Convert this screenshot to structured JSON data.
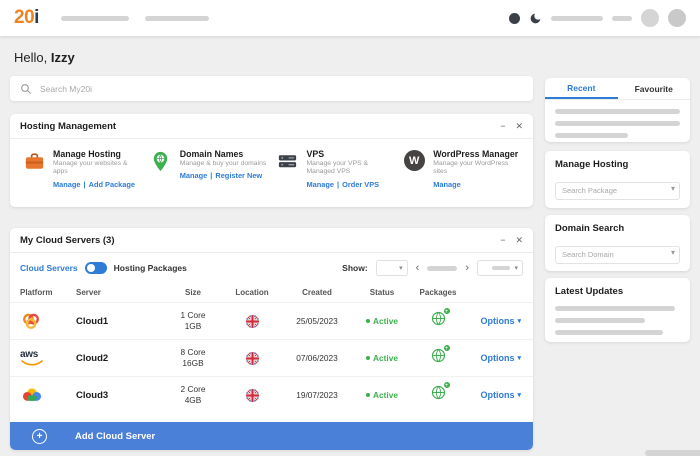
{
  "topbar": {
    "logo_main": "20",
    "logo_i": "i"
  },
  "icons": {
    "minimize": "−",
    "close": "✕",
    "chevron_down": "▾",
    "chevron_left": "‹",
    "chevron_right": "›",
    "plus": "+",
    "pipe": "|",
    "wordpress_w": "W"
  },
  "greeting": {
    "prefix": "Hello,",
    "name": "Izzy"
  },
  "search": {
    "placeholder": "Search My20i"
  },
  "hosting_management": {
    "title": "Hosting Management",
    "items": [
      {
        "title": "Manage Hosting",
        "subtitle": "Manage your websites & apps",
        "link1": "Manage",
        "link2": "Add Package"
      },
      {
        "title": "Domain Names",
        "subtitle": "Manage & buy your domains",
        "link1": "Manage",
        "link2": "Register New"
      },
      {
        "title": "VPS",
        "subtitle": "Manage your VPS & Managed VPS",
        "link1": "Manage",
        "link2": "Order VPS"
      },
      {
        "title": "WordPress Manager",
        "subtitle": "Manage your WordPress sites",
        "link1": "Manage"
      }
    ]
  },
  "cloud_servers": {
    "title": "My Cloud Servers (3)",
    "toggle": {
      "left": "Cloud Servers",
      "right": "Hosting Packages"
    },
    "show_label": "Show:",
    "columns": [
      "Platform",
      "Server",
      "Size",
      "Location",
      "Created",
      "Status",
      "Packages"
    ],
    "aws_label": "aws",
    "rows": [
      {
        "server": "Cloud1",
        "cores": "1 Core",
        "ram": "1GB",
        "created": "25/05/2023",
        "status": "Active",
        "options": "Options"
      },
      {
        "server": "Cloud2",
        "cores": "8 Core",
        "ram": "16GB",
        "created": "07/06/2023",
        "status": "Active",
        "options": "Options"
      },
      {
        "server": "Cloud3",
        "cores": "2 Core",
        "ram": "4GB",
        "created": "19/07/2023",
        "status": "Active",
        "options": "Options"
      }
    ],
    "add_button": "Add Cloud Server"
  },
  "sidebar": {
    "tabs": {
      "recent": "Recent",
      "favourite": "Favourite"
    },
    "manage_hosting": {
      "title": "Manage Hosting",
      "placeholder": "Search Package"
    },
    "domain_search": {
      "title": "Domain Search",
      "placeholder": "Search Domain"
    },
    "latest_updates": {
      "title": "Latest Updates"
    }
  },
  "colors": {
    "accent_blue": "#2e7cd6",
    "button_blue": "#4a80d8",
    "status_green": "#3daf4f",
    "brand_orange": "#f0821e"
  }
}
